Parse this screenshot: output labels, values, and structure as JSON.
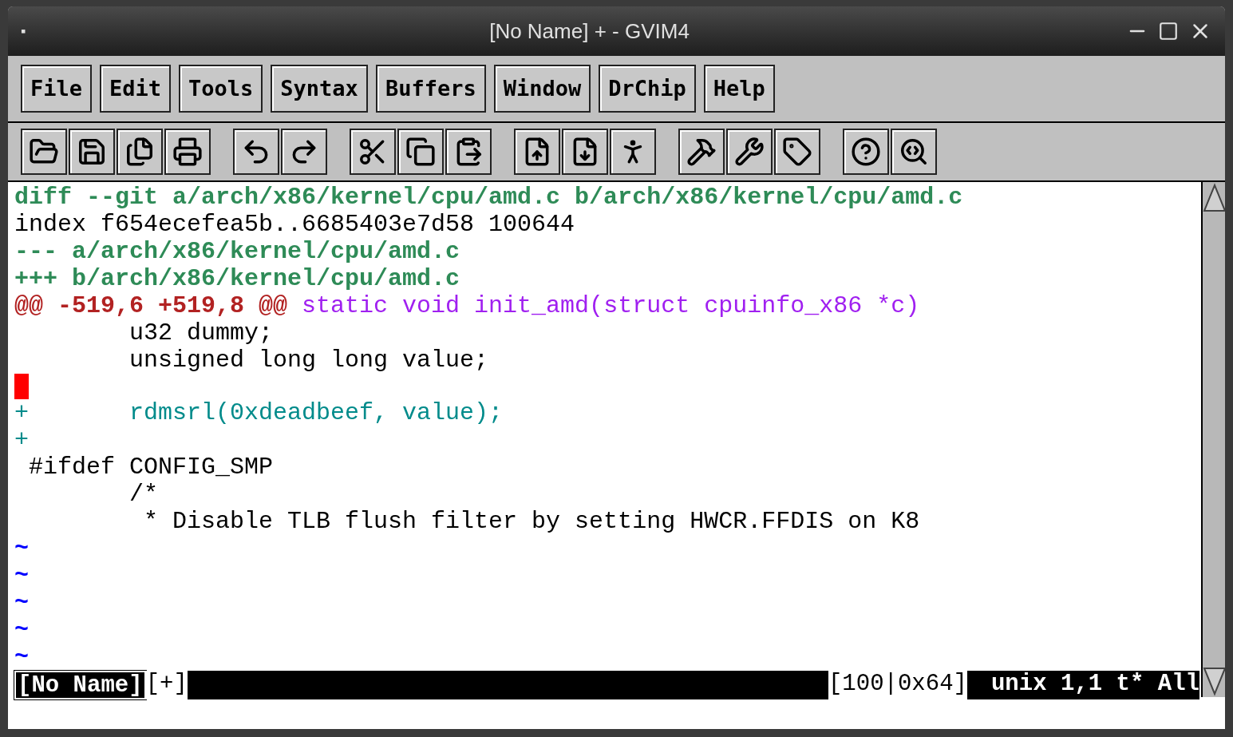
{
  "window": {
    "title": "[No Name] + - GVIM4",
    "menu_glyph": "▪"
  },
  "menu": [
    "File",
    "Edit",
    "Tools",
    "Syntax",
    "Buffers",
    "Window",
    "DrChip",
    "Help"
  ],
  "editor": {
    "lines": [
      [
        {
          "kind": "header",
          "text": "diff --git a/arch/x86/kernel/cpu/amd.c b/arch/x86/kernel/cpu/amd.c"
        }
      ],
      [
        {
          "kind": "normal",
          "text": "index f654ecefea5b..6685403e7d58 100644"
        }
      ],
      [
        {
          "kind": "header",
          "text": "--- a/arch/x86/kernel/cpu/amd.c"
        }
      ],
      [
        {
          "kind": "header",
          "text": "+++ b/arch/x86/kernel/cpu/amd.c"
        }
      ],
      [
        {
          "kind": "hunk",
          "text": "@@ -519,6 +519,8 @@"
        },
        {
          "kind": "func",
          "text": " static void init_amd(struct cpuinfo_x86 *c)"
        }
      ],
      [
        {
          "kind": "normal",
          "text": "        u32 dummy;"
        }
      ],
      [
        {
          "kind": "normal",
          "text": "        unsigned long long value;"
        }
      ],
      [
        {
          "kind": "cursor"
        }
      ],
      [
        {
          "kind": "added",
          "text": "+       rdmsrl(0xdeadbeef, value);"
        }
      ],
      [
        {
          "kind": "added",
          "text": "+"
        }
      ],
      [
        {
          "kind": "normal",
          "text": " #ifdef CONFIG_SMP"
        }
      ],
      [
        {
          "kind": "normal",
          "text": "        /*"
        }
      ],
      [
        {
          "kind": "normal",
          "text": "         * Disable TLB flush filter by setting HWCR.FFDIS on K8"
        }
      ],
      [
        {
          "kind": "tilde",
          "text": "~"
        }
      ],
      [
        {
          "kind": "tilde",
          "text": "~"
        }
      ],
      [
        {
          "kind": "tilde",
          "text": "~"
        }
      ],
      [
        {
          "kind": "tilde",
          "text": "~"
        }
      ],
      [
        {
          "kind": "tilde",
          "text": "~"
        }
      ]
    ]
  },
  "status_bar": {
    "filename": "[No Name]",
    "modified": "[+]",
    "info": "[100|0x64]",
    "position": "unix 1,1 t* All"
  }
}
